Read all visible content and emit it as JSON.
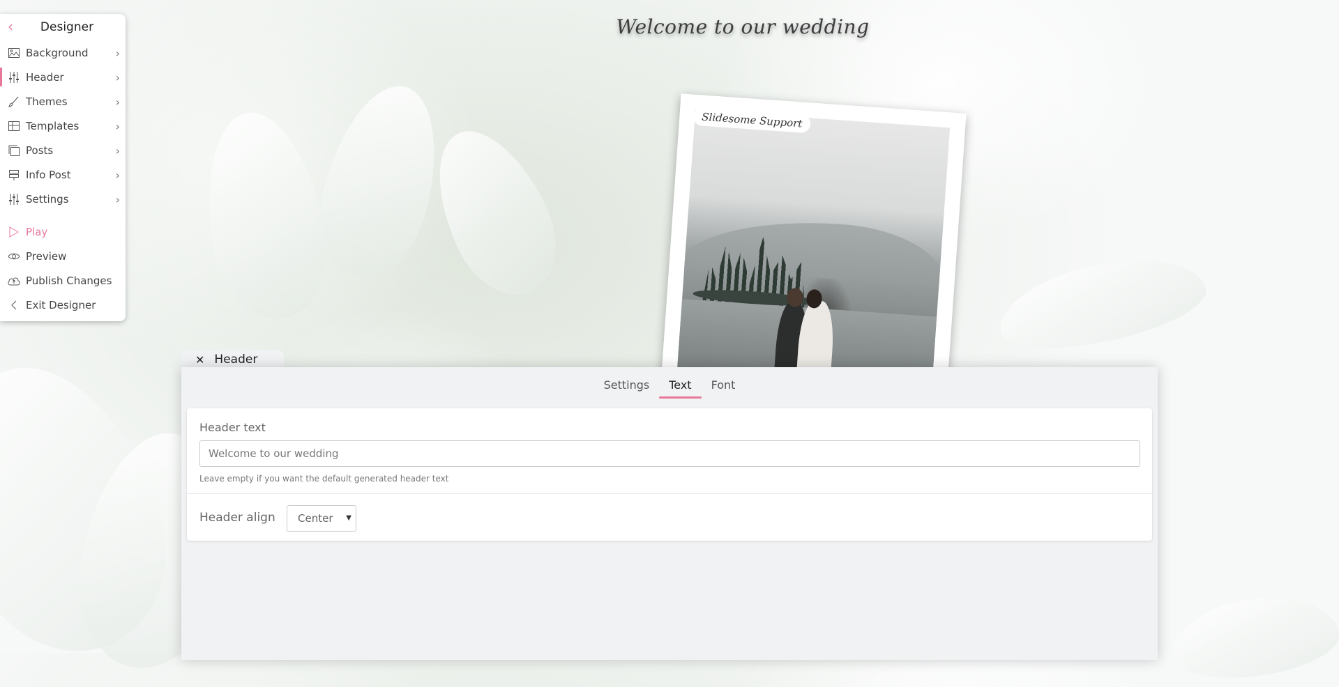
{
  "page": {
    "title": "Welcome to our wedding"
  },
  "sidebar": {
    "title": "Designer",
    "items": [
      {
        "label": "Background",
        "icon": "image-icon",
        "chevron": true
      },
      {
        "label": "Header",
        "icon": "sliders-icon",
        "chevron": true,
        "active": true
      },
      {
        "label": "Themes",
        "icon": "brush-icon",
        "chevron": true
      },
      {
        "label": "Templates",
        "icon": "grid-icon",
        "chevron": true
      },
      {
        "label": "Posts",
        "icon": "stack-icon",
        "chevron": true
      },
      {
        "label": "Info Post",
        "icon": "signpost-icon",
        "chevron": true
      },
      {
        "label": "Settings",
        "icon": "sliders-icon",
        "chevron": true
      }
    ],
    "actions": [
      {
        "label": "Play",
        "icon": "play-icon"
      },
      {
        "label": "Preview",
        "icon": "eye-icon"
      },
      {
        "label": "Publish Changes",
        "icon": "cloud-upload-icon"
      },
      {
        "label": "Exit Designer",
        "icon": "chevron-left-icon"
      }
    ]
  },
  "photo": {
    "label": "Slidesome Support"
  },
  "panel": {
    "title": "Header",
    "tabs": [
      "Settings",
      "Text",
      "Font"
    ],
    "active_tab": "Text",
    "header_text": {
      "label": "Header text",
      "value": "Welcome to our wedding",
      "help": "Leave empty if you want the default generated header text"
    },
    "header_align": {
      "label": "Header align",
      "value": "Center"
    }
  },
  "colors": {
    "accent": "#e8789a",
    "panel_bg": "#f1f2f4"
  }
}
